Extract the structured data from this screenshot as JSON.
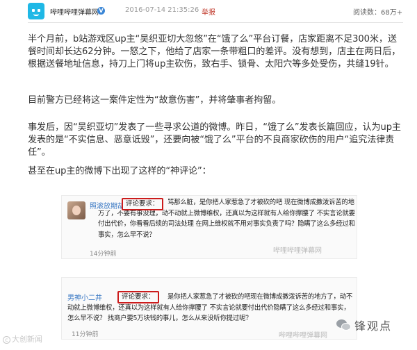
{
  "header": {
    "account_name": "哔哩哔哩弹幕网",
    "verified_mark": "V",
    "post_time": "2016-07-14 21:35:26",
    "report_label": "举报",
    "read_count": "阅读数：68万+"
  },
  "article": {
    "p1": "半个月前，b站游戏区up主“吴织亚切大忽悠”在“饿了么”平台订餐，店家距离不足300米，送餐时间却长达62分钟。一怒之下，他给了店家一条带粗口的差评。没有想到，店主在两日后，根据送餐地址信息，持刀上门将up主砍伤，致右手、锁骨、太阳穴等多处受伤，共缝19针。",
    "p2": "目前警方已经将这一案件定性为“故意伤害”，并将肇事者拘留。",
    "p3": "事发后，因“吴织亚切”发表了一些寻求公道的微博。昨日，“饿了么”发表长篇回应，认为up主发表的是“不实信息、恶意诋毁”，还要向被“饿了么”平台的不良商家砍伤的用户“追究法律责任”。",
    "p4": "甚至在up主的微博下出现了这样的“神评论”："
  },
  "comments": [
    {
      "name": "照滚放期胡",
      "label": "评论要求：",
      "text": "骂那么脏，是你把人家惹急了才被砍的吧 现在微博成撒泼诉苦的地方了，不要有事没理，动不动就上微博维权，还真以为这样就有人给你撑腰了 不实言论就要付出代价，你看看后续的司法处理 在网上维权就不用对事实负责了吗？隐瞒了这么多经过和事实，怎么早不说？",
      "time": "14分钟前",
      "watermark": "哔哩哔哩弹幕网"
    },
    {
      "name": "男神小二井",
      "label": "评论要求：",
      "text": "是你把人家惹急了才被砍的吧现在微博成撒泼诉苦的地方了，动不动就上微博维权，还真以为这样就有人给你撑腰了 不实言论就要付出代价隐瞒了这么多经过和事实，怎么早不说？ 找商户要5万块钱的事儿，怎么从来没听你提过呢？",
      "time": "11分钟前",
      "watermark": "哔哩哔哩弹幕网"
    }
  ],
  "overlays": {
    "bottom_left_watermark": "大创新闻",
    "brand_name": "锋观点"
  },
  "colors": {
    "accent_red": "#cc1c1c",
    "link_blue": "#3b79c4",
    "avatar_blue": "#1fb8e6"
  }
}
